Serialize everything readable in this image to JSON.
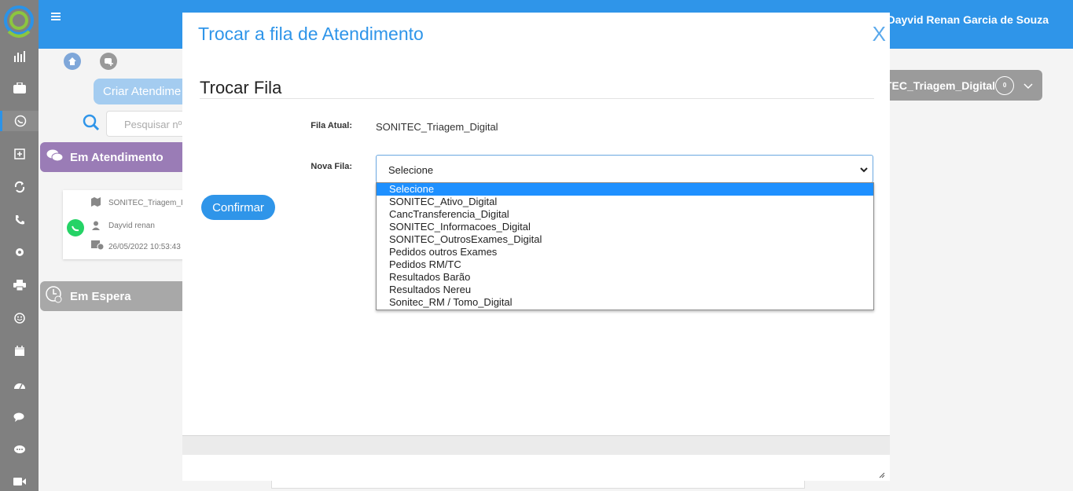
{
  "topbar": {
    "user_name": "Dayvid Renan Garcia de Souza"
  },
  "sidebar": {
    "icons": [
      "bar-chart-icon",
      "briefcase-icon",
      "whatsapp-icon",
      "plus-square-icon",
      "refresh-icon",
      "phone-icon",
      "gear-icon",
      "printer-icon",
      "smile-icon",
      "calendar-icon",
      "dashboard-icon",
      "chat-bubbles-icon",
      "comment-icon",
      "video-icon"
    ]
  },
  "background": {
    "criar_label": "Criar Atendime",
    "search_placeholder": "Pesquisar nº",
    "em_atendimento": "Em Atendimento",
    "em_espera": "Em Espera",
    "card": {
      "fila": "SONITEC_Triagem_I",
      "user": "Dayvid renan",
      "date": "26/05/2022 10:53:43"
    },
    "fila_pill": {
      "label": "TEC_Triagem_Digital",
      "count": "0"
    }
  },
  "modal": {
    "title": "Trocar a fila de Atendimento",
    "close": "X",
    "section_title": "Trocar Fila",
    "fila_atual_label": "Fila Atual:",
    "fila_atual_value": "SONITEC_Triagem_Digital",
    "nova_fila_label": "Nova Fila:",
    "select_value": "Selecione",
    "options": [
      "Selecione",
      "SONITEC_Ativo_Digital",
      "CancTransferencia_Digital",
      "SONITEC_Informacoes_Digital",
      "SONITEC_OutrosExames_Digital",
      "Pedidos outros Exames",
      "Pedidos RM/TC",
      "Resultados Barão",
      "Resultados Nereu",
      "Sonitec_RM / Tomo_Digital"
    ],
    "confirm_label": "Confirmar"
  },
  "colors": {
    "accent": "#2f95e9",
    "sidebar": "#808080",
    "purple": "#9a7cb6",
    "whatsapp": "#25d366"
  }
}
